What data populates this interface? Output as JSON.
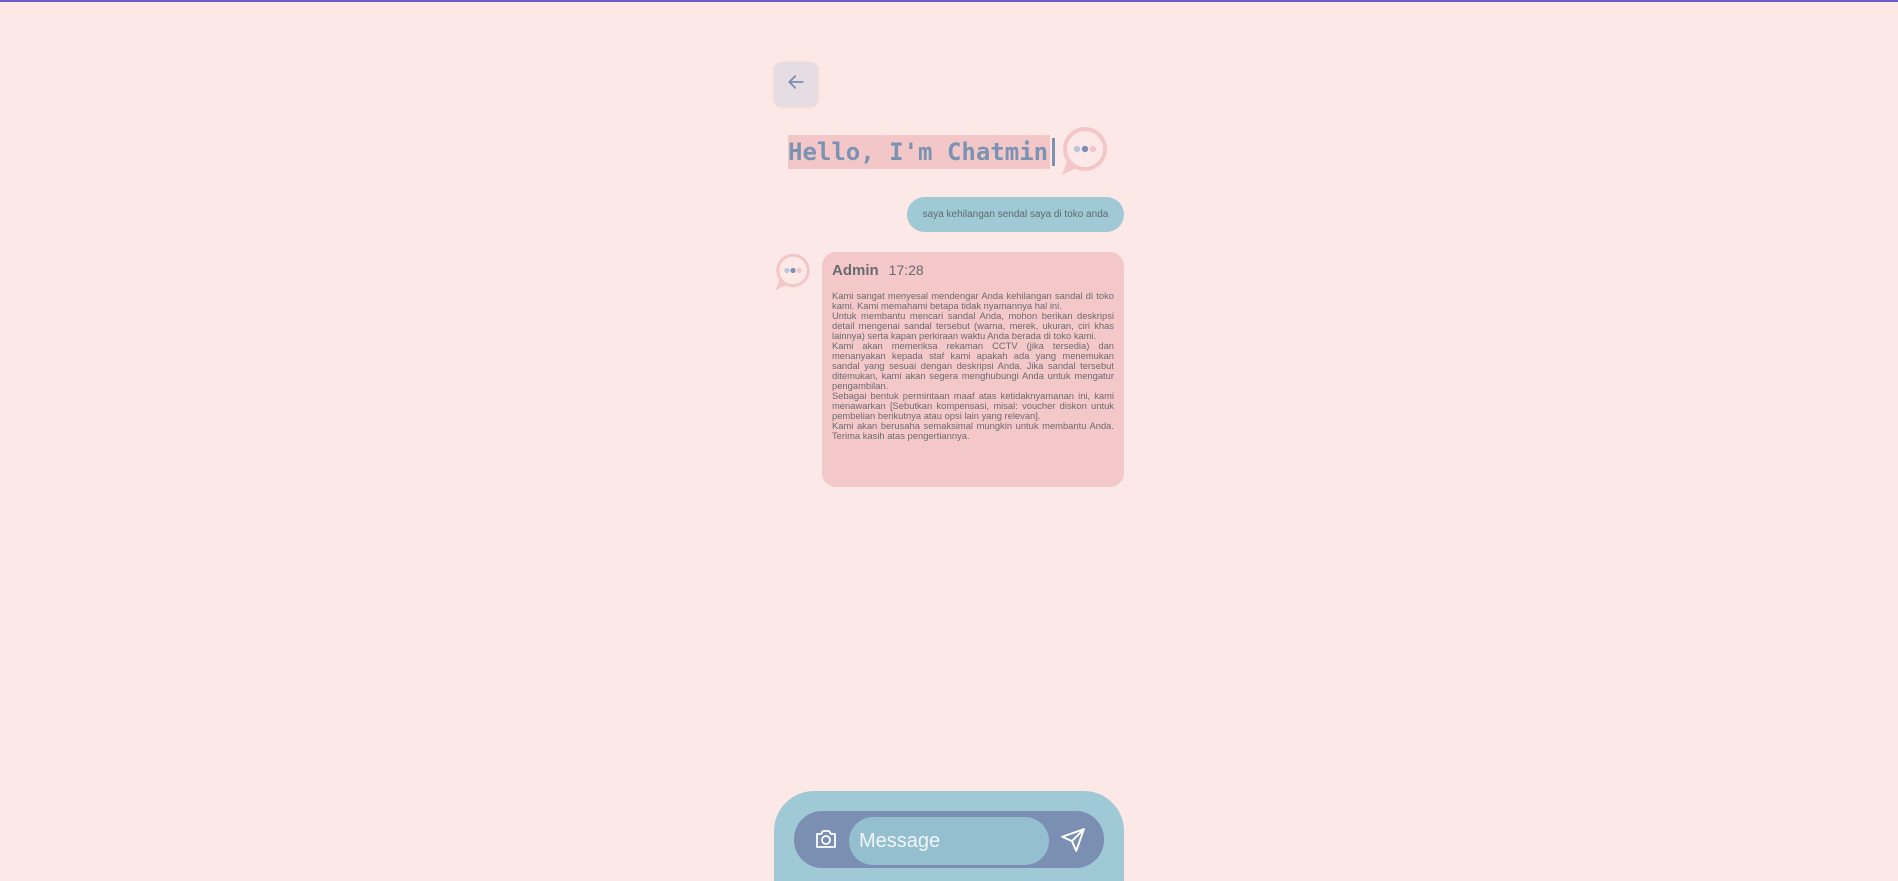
{
  "header": {
    "back_icon": "arrow-left-icon",
    "title": "Hello, I'm Chatmin",
    "logo_icon": "chat-bubble-logo-icon"
  },
  "colors": {
    "background": "#fde8e8",
    "title_text": "#7b93b3",
    "title_highlight": "#f3c6c8",
    "user_bubble": "#9ec9d5",
    "admin_bubble": "#f4c8c9",
    "composer_outer": "#9ec9d5",
    "composer_inner": "#7b8fb2",
    "top_accent": "#6b5bc9"
  },
  "messages": {
    "user": {
      "text": "saya kehilangan sendal saya di toko anda"
    },
    "admin": {
      "avatar_icon": "chat-bubble-avatar-icon",
      "name": "Admin",
      "time": "17:28",
      "paragraphs": [
        "Kami sangat menyesal mendengar Anda kehilangan sandal di toko kami. Kami memahami betapa tidak nyamannya hal ini.",
        "Untuk membantu mencari sandal Anda, mohon berikan deskripsi detail mengenai sandal tersebut (warna, merek, ukuran, ciri khas lainnya) serta kapan perkiraan waktu Anda berada di toko kami.",
        "Kami akan memeriksa rekaman CCTV (jika tersedia) dan menanyakan kepada staf kami apakah ada yang menemukan sandal yang sesuai dengan deskripsi Anda. Jika sandal tersebut ditemukan, kami akan segera menghubungi Anda untuk mengatur pengambilan.",
        "Sebagai bentuk permintaan maaf atas ketidaknyamanan ini, kami menawarkan [Sebutkan kompensasi, misal: voucher diskon untuk pembelian berikutnya atau opsi lain yang relevan].",
        "Kami akan berusaha semaksimal mungkin untuk membantu Anda. Terima kasih atas pengertiannya."
      ]
    }
  },
  "composer": {
    "camera_icon": "camera-icon",
    "placeholder": "Message",
    "send_icon": "send-icon"
  }
}
